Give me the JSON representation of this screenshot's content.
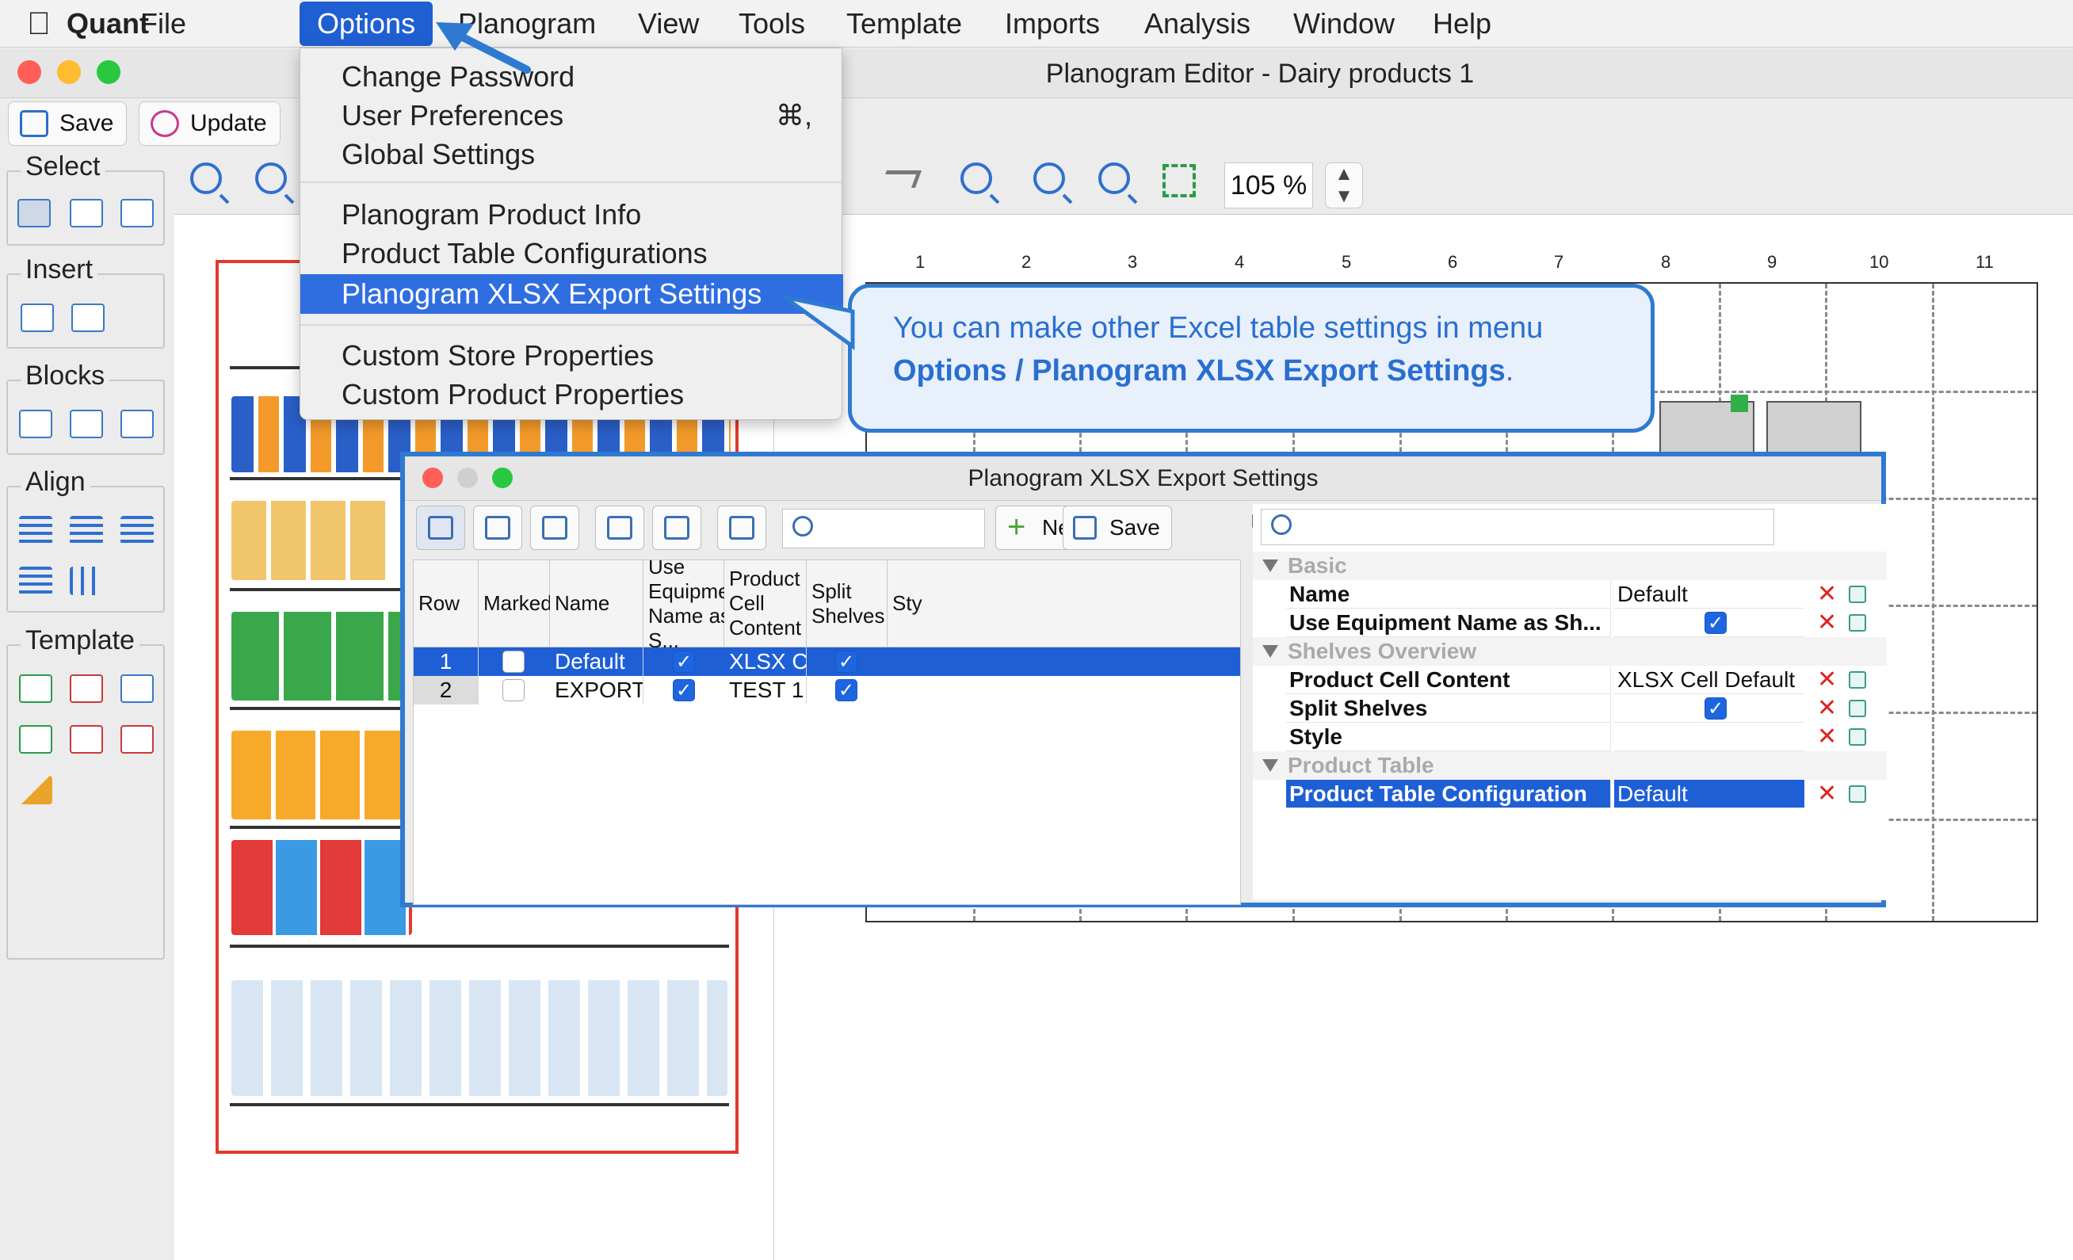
{
  "menubar": {
    "app_name": "Quant",
    "items": [
      "File",
      "Options",
      "Planogram",
      "View",
      "Tools",
      "Template",
      "Imports",
      "Analysis",
      "Window",
      "Help"
    ]
  },
  "window": {
    "title": "Planogram Editor - Dairy products 1"
  },
  "toolbar": {
    "save_label": "Save",
    "update_label": "Update",
    "zoom_value": "105 %"
  },
  "left_panel": {
    "groups": [
      "Select",
      "Insert",
      "Blocks",
      "Align",
      "Template"
    ]
  },
  "ruler": [
    "1",
    "2",
    "3",
    "4",
    "5",
    "6",
    "7",
    "8",
    "9",
    "10",
    "11"
  ],
  "options_menu": {
    "items": [
      {
        "label": "Change Password"
      },
      {
        "label": "User Preferences",
        "shortcut": "⌘,"
      },
      {
        "label": "Global Settings"
      },
      {
        "label": "Planogram Product Info"
      },
      {
        "label": "Product Table Configurations"
      },
      {
        "label": "Planogram XLSX Export Settings",
        "selected": true
      },
      {
        "label": "Custom Store Properties"
      },
      {
        "label": "Custom Product Properties"
      }
    ]
  },
  "callout": {
    "line1": "You can make other Excel table settings in menu",
    "line2": "Options / Planogram XLSX Export Settings",
    "line2_suffix": "."
  },
  "dialog": {
    "title": "Planogram XLSX Export Settings",
    "new_label": "New",
    "save_label": "Save",
    "columns": [
      "Row",
      "Marked",
      "Name",
      "Use Equipment Name as S...",
      "Product Cell Content",
      "Split Shelves",
      "Sty"
    ],
    "rows": [
      {
        "row": "1",
        "marked": false,
        "name": "Default",
        "use_equipment": true,
        "content": "XLSX Cell ...",
        "split": true,
        "selected": true
      },
      {
        "row": "2",
        "marked": false,
        "name": "EXPORT TEST",
        "use_equipment": true,
        "content": "TEST 1",
        "split": true,
        "selected": false
      }
    ],
    "properties": {
      "groups": [
        "Basic",
        "Shelves Overview",
        "Product Table"
      ],
      "items": [
        {
          "name": "Name",
          "value": "Default"
        },
        {
          "name": "Use Equipment Name as Sh...",
          "checked": true
        },
        {
          "name": "Product Cell Content",
          "value": "XLSX Cell Default"
        },
        {
          "name": "Split Shelves",
          "checked": true
        },
        {
          "name": "Style",
          "value": ""
        },
        {
          "name": "Product Table Configuration",
          "value": "Default",
          "selected": true
        }
      ]
    }
  },
  "colors": {
    "accent": "#2f6ee0",
    "callout_border": "#2f7ad1",
    "shelf_border": "#e23a2a"
  }
}
